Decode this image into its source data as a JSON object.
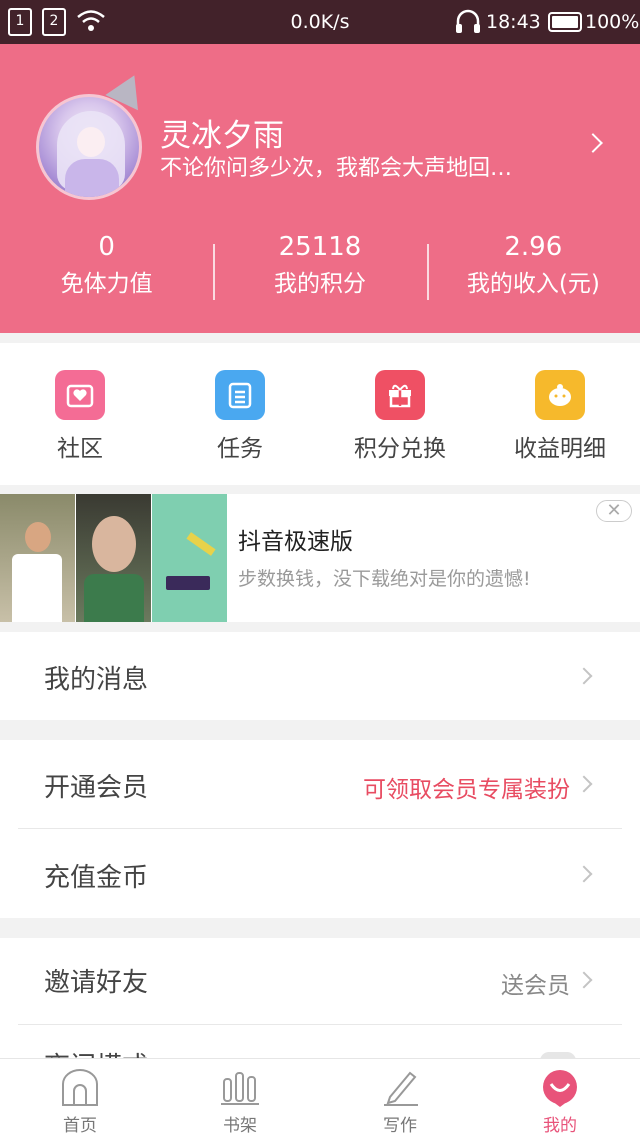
{
  "status_bar": {
    "sim1": "1",
    "sim2": "2",
    "net_speed": "0.0K/s",
    "time": "18:43",
    "battery": "100%"
  },
  "profile": {
    "name": "灵冰夕雨",
    "signature": "不论你问多少次，我都会大声地回…",
    "stats": [
      {
        "value": "0",
        "label": "免体力值"
      },
      {
        "value": "25118",
        "label": "我的积分"
      },
      {
        "value": "2.96",
        "label": "我的收入(元)"
      }
    ]
  },
  "quick_actions": [
    {
      "label": "社区",
      "icon": "community-icon",
      "color": "#f46c95"
    },
    {
      "label": "任务",
      "icon": "task-icon",
      "color": "#4aa8f0"
    },
    {
      "label": "积分兑换",
      "icon": "gift-icon",
      "color": "#ef5064"
    },
    {
      "label": "收益明细",
      "icon": "piggy-bank-icon",
      "color": "#f6b92c"
    }
  ],
  "ad": {
    "title": "抖音极速版",
    "description": "步数换钱，没下载绝对是你的遗憾!",
    "close": "✕"
  },
  "menu": {
    "messages": {
      "label": "我的消息"
    },
    "vip": {
      "label": "开通会员",
      "value": "可领取会员专属装扮",
      "value_color": "#e84c62"
    },
    "recharge": {
      "label": "充值金币"
    },
    "invite": {
      "label": "邀请好友",
      "value": "送会员"
    },
    "partial_label": "夜间模式"
  },
  "bottom_nav": [
    {
      "label": "首页",
      "icon": "home-icon"
    },
    {
      "label": "书架",
      "icon": "bookshelf-icon"
    },
    {
      "label": "写作",
      "icon": "pen-icon"
    },
    {
      "label": "我的",
      "icon": "profile-icon",
      "active": true
    }
  ],
  "colors": {
    "header_pink": "#ee6d87",
    "status_bar": "#42222a",
    "active_nav": "#e8537a"
  }
}
